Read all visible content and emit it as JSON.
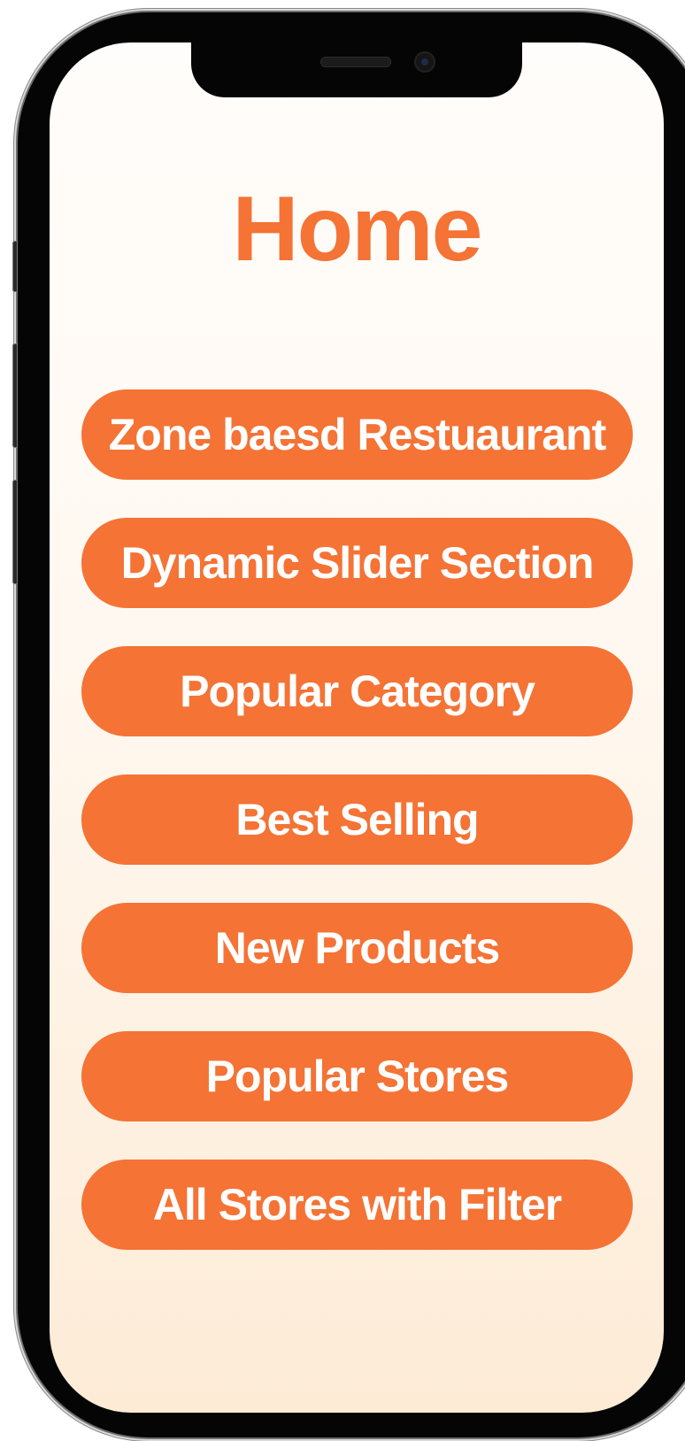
{
  "page": {
    "title": "Home"
  },
  "menu": {
    "items": [
      {
        "label": "Zone baesd Restuaurant"
      },
      {
        "label": "Dynamic Slider Section"
      },
      {
        "label": "Popular Category"
      },
      {
        "label": "Best Selling"
      },
      {
        "label": "New Products"
      },
      {
        "label": "Popular Stores"
      },
      {
        "label": "All Stores with Filter"
      }
    ]
  },
  "theme": {
    "accent": "#f47335",
    "button_text": "#ffffff",
    "bg_top": "#fffdfb",
    "bg_bottom": "#fdebd6"
  }
}
